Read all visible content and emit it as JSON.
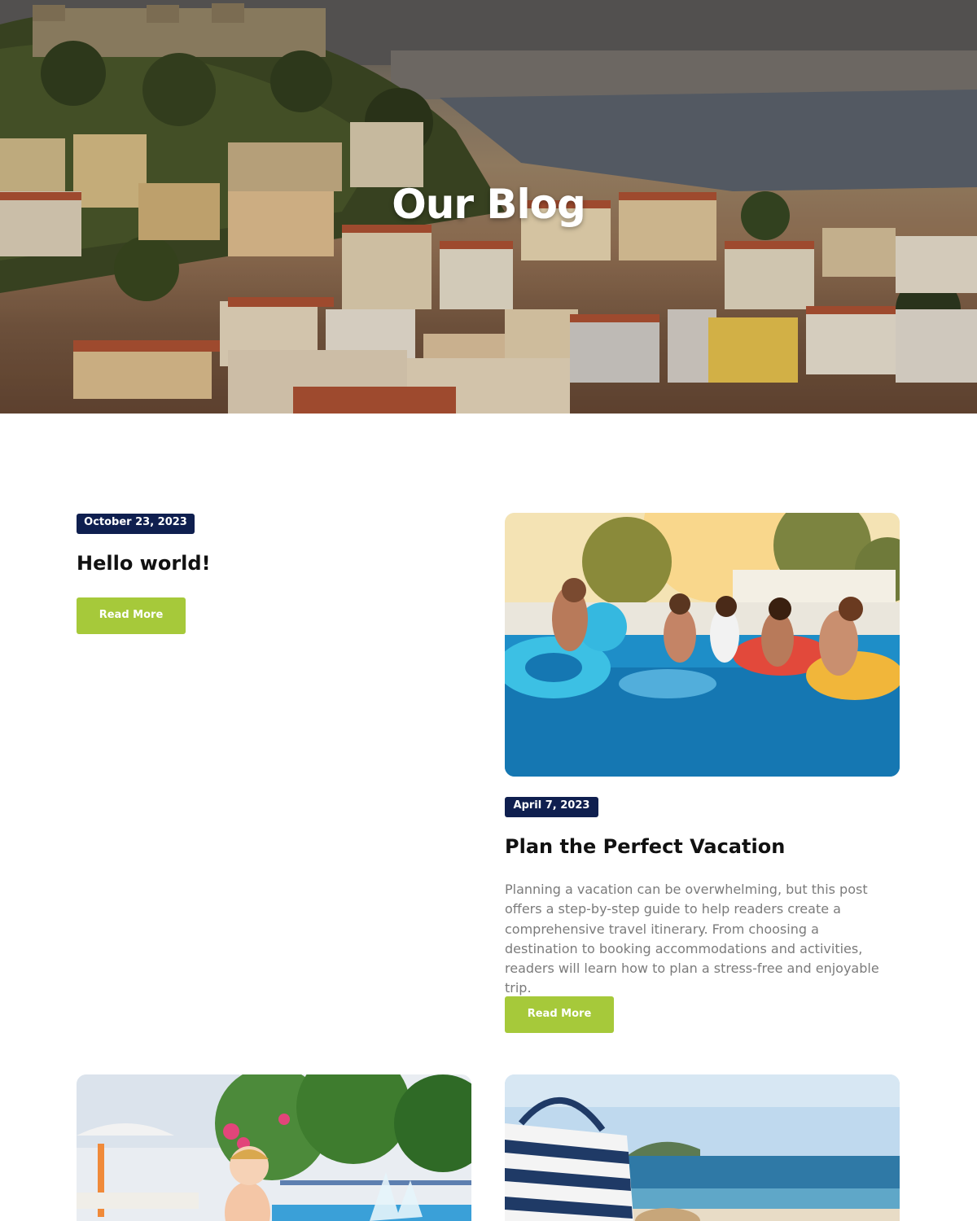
{
  "hero": {
    "title": "Our Blog"
  },
  "posts": [
    {
      "date": "October 23, 2023",
      "title": "Hello world!",
      "read_more": "Read More"
    },
    {
      "date": "April 7, 2023",
      "title": "Plan the Perfect Vacation",
      "excerpt": "Planning a vacation can be overwhelming, but this post offers a step-by-step guide to help readers create a comprehensive travel itinerary. From choosing a destination to booking accommodations and activities, readers will learn how to plan a stress-free and enjoyable trip.",
      "read_more": "Read More"
    }
  ],
  "colors": {
    "date_badge": "#0f1f4f",
    "read_more": "#a6c93a",
    "title_text": "#111111",
    "excerpt_text": "#7b7b7b"
  }
}
